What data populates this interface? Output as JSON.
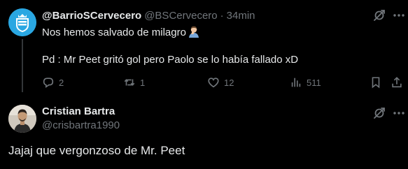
{
  "tweet1": {
    "author_name": "@BarrioSCervecero",
    "handle": "@BSCervecero",
    "separator": "·",
    "time": "34min",
    "line1": "Nos hemos salvado de milagro",
    "line2": "Pd : Mr Peet gritó gol pero Paolo se lo había fallado xD",
    "avatar_icon": "club-crest-icon",
    "emoji_icon": "facepalm-emoji-icon",
    "stats": {
      "replies": "2",
      "reposts": "1",
      "likes": "12",
      "views": "511"
    }
  },
  "tweet2": {
    "author_name": "Cristian Bartra",
    "handle": "@crisbartra1990",
    "text": "Jajaj que vergonzoso de Mr. Peet",
    "avatar_icon": "profile-photo"
  },
  "colors": {
    "background": "#000000",
    "text_primary": "#e7e9ea",
    "text_secondary": "#71767b",
    "divider": "#333639",
    "avatar1_bg": "#2aa7e2"
  }
}
